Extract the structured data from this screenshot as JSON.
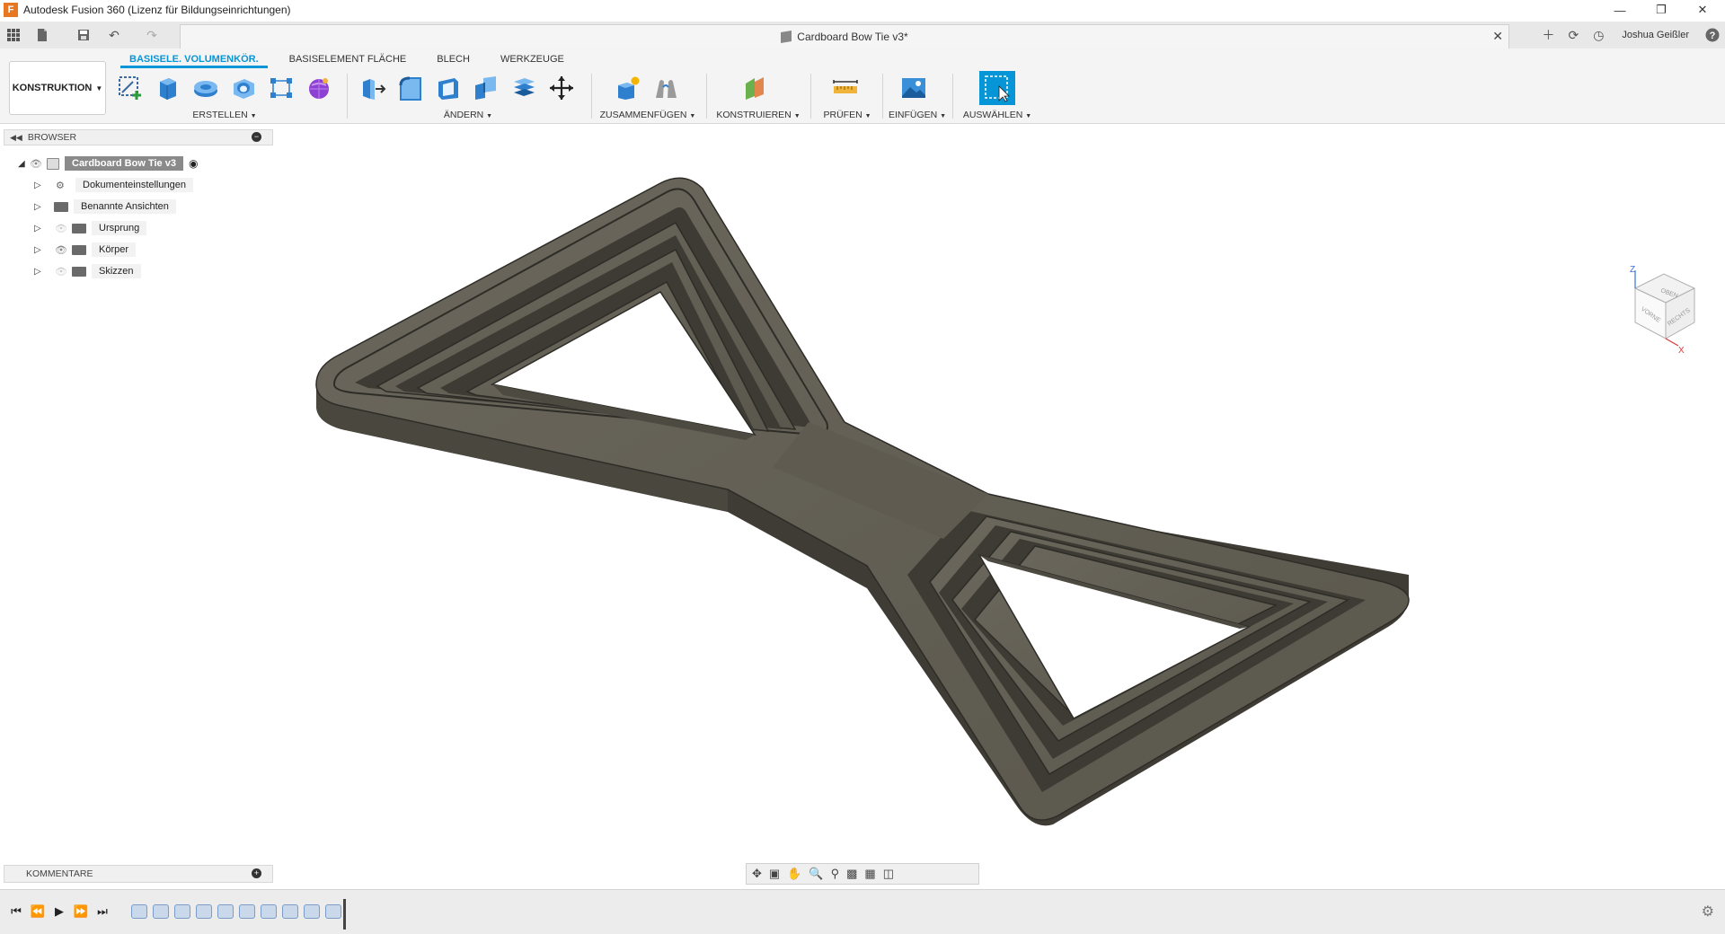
{
  "window": {
    "title": "Autodesk Fusion 360 (Lizenz für Bildungseinrichtungen)",
    "logo_letter": "F"
  },
  "doc_tab": {
    "title": "Cardboard Bow Tie v3*"
  },
  "user": {
    "name": "Joshua Geißler"
  },
  "toolbar": {
    "workspace": "KONSTRUKTION",
    "tabs": [
      "BASISELE. VOLUMENKÖR.",
      "BASISELEMENT FLÄCHE",
      "BLECH",
      "WERKZEUGE"
    ],
    "groups": {
      "erstellen": "ERSTELLEN",
      "aendern": "ÄNDERN",
      "zusammenfuegen": "ZUSAMMENFÜGEN",
      "konstruieren": "KONSTRUIEREN",
      "pruefen": "PRÜFEN",
      "einfuegen": "EINFÜGEN",
      "auswaehlen": "AUSWÄHLEN"
    }
  },
  "browser": {
    "header": "BROWSER",
    "root": "Cardboard Bow Tie v3",
    "items": [
      "Dokumenteinstellungen",
      "Benannte Ansichten",
      "Ursprung",
      "Körper",
      "Skizzen"
    ]
  },
  "viewcube": {
    "top": "OBEN",
    "front": "VORNE",
    "right": "RECHTS",
    "z": "Z",
    "x": "X"
  },
  "comments": {
    "label": "KOMMENTARE"
  },
  "colors": {
    "accent": "#0696d7",
    "model": "#5f5b51"
  }
}
